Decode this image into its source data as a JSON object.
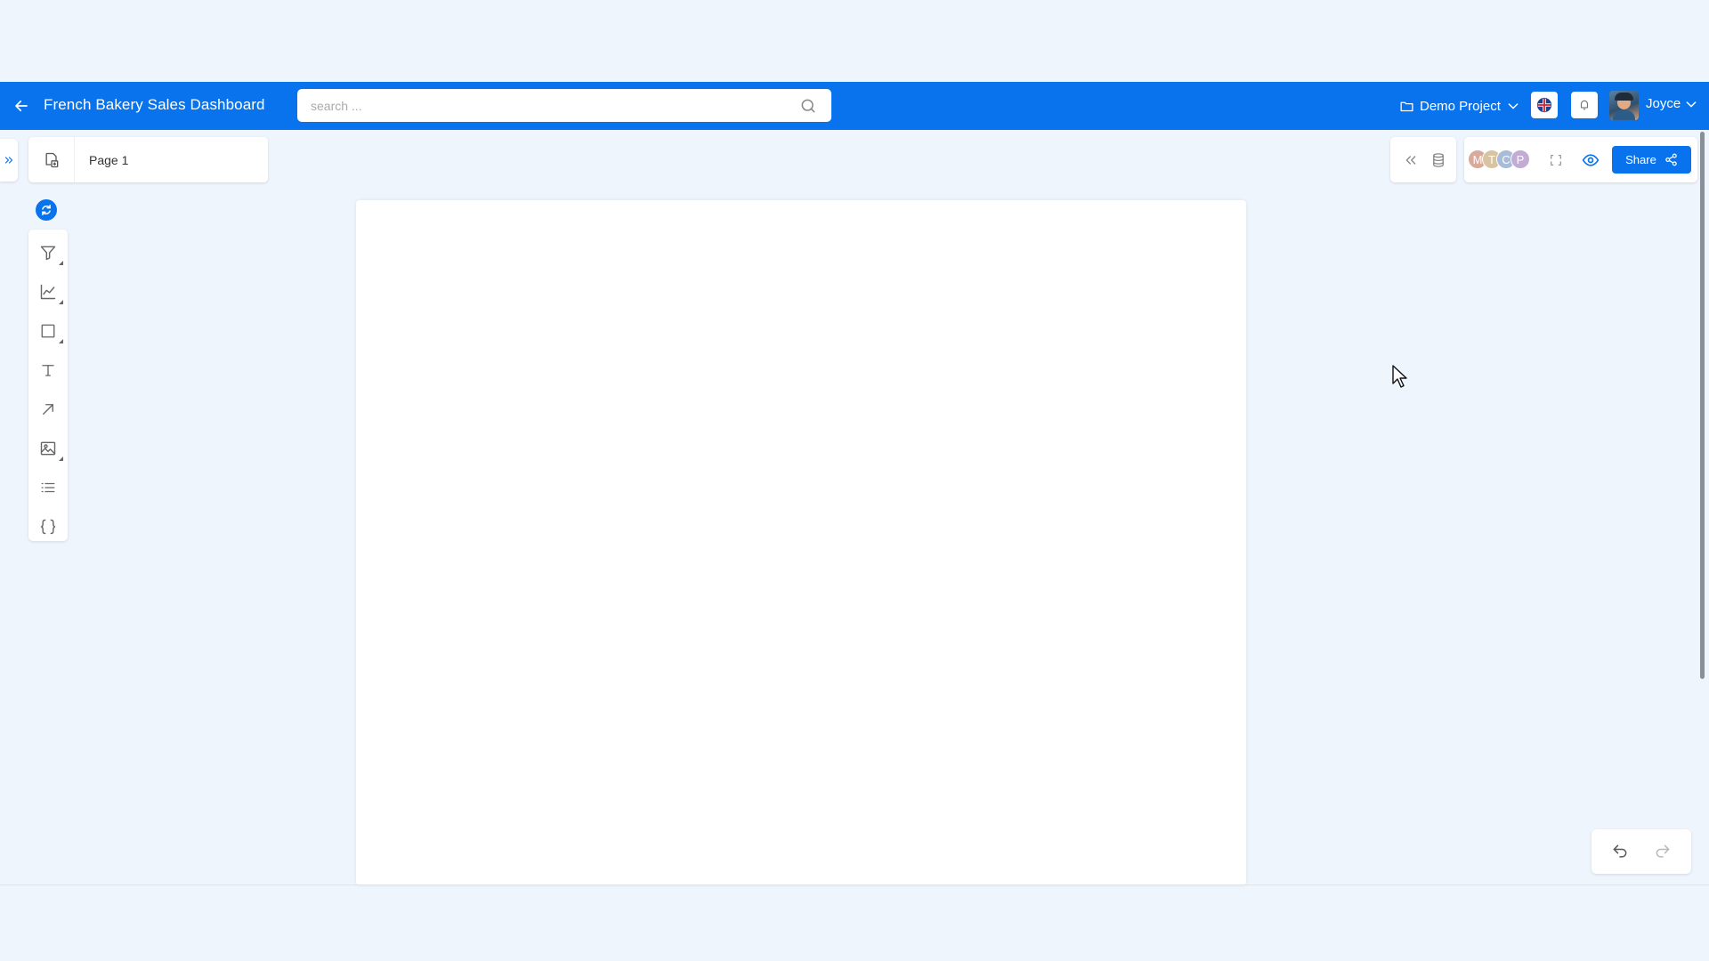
{
  "header": {
    "title": "French Bakery Sales Dashboard",
    "back_icon": "arrow-left-icon",
    "search": {
      "placeholder": "search ...",
      "value": ""
    },
    "project": {
      "label": "Demo Project",
      "icon": "folder-icon"
    },
    "user": {
      "name": "Joyce"
    },
    "colors": {
      "bar": "#0873ed"
    }
  },
  "pages": {
    "current": {
      "label": "Page 1",
      "icon": "pages-icon"
    }
  },
  "toolbar": {
    "tools": [
      {
        "name": "filter-icon"
      },
      {
        "name": "chart-icon"
      },
      {
        "name": "shape-icon"
      },
      {
        "name": "text-icon"
      },
      {
        "name": "arrow-icon"
      },
      {
        "name": "image-icon"
      },
      {
        "name": "list-icon"
      },
      {
        "name": "code-icon"
      }
    ]
  },
  "right_panel": {
    "collaborators": [
      "M",
      "T",
      "C",
      "P"
    ],
    "share_label": "Share"
  }
}
